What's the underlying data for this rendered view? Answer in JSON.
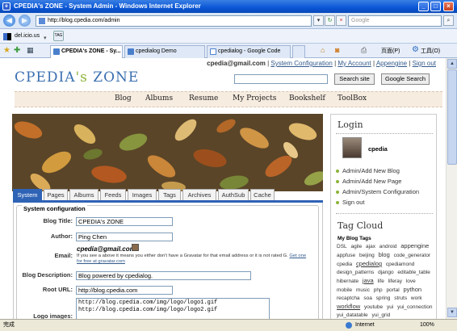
{
  "window": {
    "title": "CPEDIA's ZONE - System Admin - Windows Internet Explorer"
  },
  "address": {
    "url": "http://blog.cpedia.com/admin",
    "search_placeholder": "Google"
  },
  "linksbar": {
    "item": "del.icio.us",
    "tag": "TAG"
  },
  "browser_tabs": [
    {
      "label": "CPEDIA's ZONE - Sy..."
    },
    {
      "label": "cpedialog Demo"
    },
    {
      "label": "cpedialog - Google Code"
    }
  ],
  "browser_tools": {
    "page": "页面(P)",
    "tools": "工具(O)"
  },
  "status": {
    "left": "完成",
    "zone": "Internet",
    "zoom": "100%"
  },
  "toplinks": {
    "email": "cpedia@gmail.com",
    "syscfg": "System Configuration",
    "account": "My Account",
    "appengine": "Appengine",
    "signout": "Sign out"
  },
  "logo": {
    "part1": "CPEDIA",
    "part2": "'s ",
    "part3": "ZONE"
  },
  "search": {
    "site_btn": "Search site",
    "google_btn": "Google Search"
  },
  "nav": [
    "Blog",
    "Albums",
    "Resume",
    "My Projects",
    "Bookshelf",
    "ToolBox"
  ],
  "admin_tabs": [
    "System",
    "Pages",
    "Albums",
    "Feeds",
    "Images",
    "Tags",
    "Archives",
    "AuthSub",
    "Cache"
  ],
  "config": {
    "legend": "System configuration",
    "blog_title_label": "Blog Title:",
    "blog_title": "CPEDIA's ZONE",
    "author_label": "Author:",
    "author": "Ping Chen",
    "email_label": "Email:",
    "email": "cpedia@gmail.com",
    "gravatar_note": "If you see a  above it means you either don't have a Gravatar for that email address or it is not rated G.",
    "gravatar_link": "Get one for free at gravatar.com",
    "desc_label": "Blog Description:",
    "desc": "Blog powered by cpedialog.",
    "root_label": "Root URL:",
    "root": "http://blog.cpedia.com",
    "logo_label": "Logo images:",
    "logo1": "http://blog.cpedia.com/img/logo/logo1.gif",
    "logo2": "http://blog.cpedia.com/img/logo/logo2.gif"
  },
  "sidebar": {
    "login_title": "Login",
    "user": "cpedia",
    "links": [
      "Admin/Add New Blog",
      "Admin/Add New Page",
      "Admin/System Configuration",
      "Sign out"
    ],
    "tagcloud_title": "Tag Cloud",
    "tags_header": "My Blog Tags",
    "tags": [
      "DSL",
      "agile",
      "ajax",
      "android",
      "appengine",
      "appfuse",
      "beijing",
      "blog",
      "code_generator",
      "cpedia",
      "cpedialog",
      "cpediamond",
      "design_patterns",
      "django",
      "editable_table",
      "hibernate",
      "java",
      "life",
      "liferay",
      "love",
      "mobile",
      "music",
      "php",
      "portal",
      "python",
      "recaptcha",
      "soa",
      "spring",
      "struts",
      "work",
      "workflow",
      "youtube",
      "yui",
      "yui_connection",
      "yui_datatable",
      "yui_grid"
    ]
  }
}
